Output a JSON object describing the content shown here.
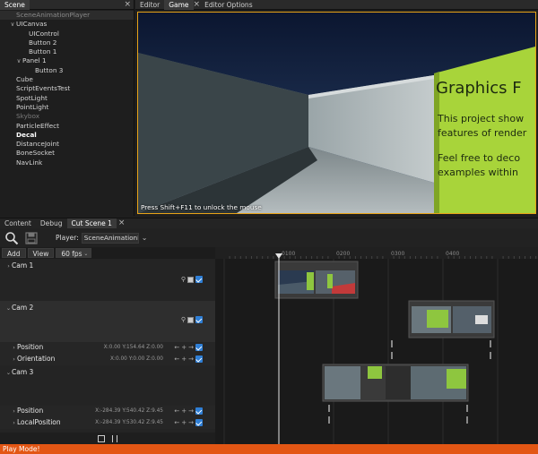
{
  "scene": {
    "tab_label": "Scene",
    "close_glyph": "×",
    "tree": [
      {
        "label": "SceneAnimationPlayer",
        "indent": 0,
        "toggle": "",
        "style": "sel"
      },
      {
        "label": "UICanvas",
        "indent": 0,
        "toggle": "v",
        "style": ""
      },
      {
        "label": "UIControl",
        "indent": 2,
        "toggle": "",
        "style": ""
      },
      {
        "label": "Button 2",
        "indent": 2,
        "toggle": "",
        "style": ""
      },
      {
        "label": "Button 1",
        "indent": 2,
        "toggle": "",
        "style": ""
      },
      {
        "label": "Panel 1",
        "indent": 1,
        "toggle": "v",
        "style": ""
      },
      {
        "label": "Button 3",
        "indent": 3,
        "toggle": "",
        "style": ""
      },
      {
        "label": "Cube",
        "indent": 0,
        "toggle": "",
        "style": ""
      },
      {
        "label": "ScriptEventsTest",
        "indent": 0,
        "toggle": "",
        "style": ""
      },
      {
        "label": "SpotLight",
        "indent": 0,
        "toggle": "",
        "style": ""
      },
      {
        "label": "PointLight",
        "indent": 0,
        "toggle": "",
        "style": ""
      },
      {
        "label": "Skybox",
        "indent": 0,
        "toggle": "",
        "style": "dim"
      },
      {
        "label": "ParticleEffect",
        "indent": 0,
        "toggle": "",
        "style": ""
      },
      {
        "label": "Decal",
        "indent": 0,
        "toggle": "",
        "style": "bold"
      },
      {
        "label": "DistanceJoint",
        "indent": 0,
        "toggle": "",
        "style": ""
      },
      {
        "label": "BoneSocket",
        "indent": 0,
        "toggle": "",
        "style": ""
      },
      {
        "label": "NavLink",
        "indent": 0,
        "toggle": "",
        "style": ""
      }
    ]
  },
  "game": {
    "tabs": [
      {
        "label": "Editor",
        "active": false
      },
      {
        "label": "Game",
        "active": true
      },
      {
        "label": "Editor Options",
        "active": false
      }
    ],
    "close_glyph": "×",
    "unlock_hint": "Press Shift+F11 to unlock the mouse",
    "sign_lines": [
      "Graphics F",
      "This project show",
      "features of render",
      "Feel free to deco",
      "examples within"
    ]
  },
  "bottom_tabs": [
    {
      "label": "Content",
      "active": false
    },
    {
      "label": "Debug",
      "active": false
    },
    {
      "label": "Cut Scene 1",
      "active": true
    }
  ],
  "bottom_close_glyph": "×",
  "toolbar": {
    "search_icon": "search-icon",
    "save_icon": "save-icon",
    "player_label": "Player:",
    "player_value": "SceneAnimationPlayer",
    "chevron": "⌄"
  },
  "track_header": {
    "add_label": "Add",
    "view_label": "View",
    "fps_value": "60 fps"
  },
  "tracks": {
    "cam1": {
      "title": "Cam 1"
    },
    "cam2": {
      "title": "Cam 2"
    },
    "cam2_position": {
      "title": "Position",
      "coords": "X:0.00 Y:154.64 Z:0.00"
    },
    "cam2_orientation": {
      "title": "Orientation",
      "coords": "X:0.00 Y:0.00 Z:0.00"
    },
    "cam3": {
      "title": "Cam 3"
    },
    "cam3_position": {
      "title": "Position",
      "coords": "X:-284.39 Y:540.42 Z:9.45"
    },
    "cam3_localposition": {
      "title": "LocalPosition",
      "coords": "X:-284.39 Y:530.42 Z:9.45"
    }
  },
  "track_controls": {
    "left_arrow": "←",
    "add": "+",
    "right_arrow": "→"
  },
  "footer": {
    "stop_icon": "stop-icon",
    "pause_icon": "pause-icon"
  },
  "timeline": {
    "ruler_labels": [
      "0100",
      "0200",
      "0300",
      "0400"
    ]
  },
  "status": {
    "text": "Play Mode!"
  },
  "colors": {
    "accent_orange": "#e35614",
    "viewport_border": "#e8a317",
    "checkbox_blue": "#2f7fd6",
    "sign_green": "#a8d43a"
  }
}
